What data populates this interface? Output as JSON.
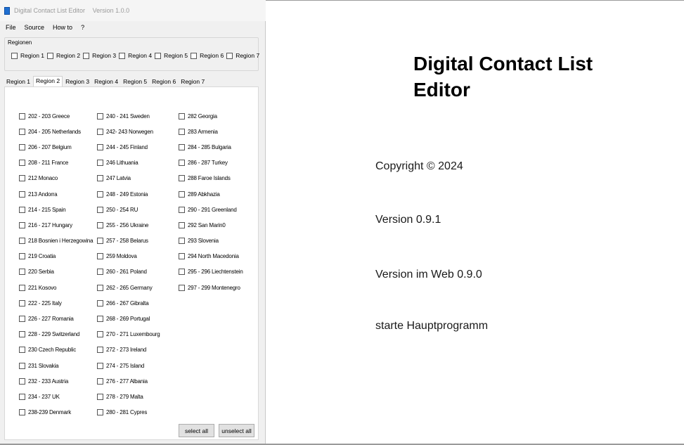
{
  "window": {
    "title": "Digital Contact List Editor",
    "version": "Version 1.0.0"
  },
  "menu": [
    "File",
    "Source",
    "How to",
    "?"
  ],
  "regionen": {
    "label": "Regionen",
    "checks": [
      "Region 1",
      "Region 2",
      "Region 3",
      "Region 4",
      "Region 5",
      "Region 6",
      "Region 7"
    ]
  },
  "tabs": [
    "Region 1",
    "Region 2",
    "Region 3",
    "Region 4",
    "Region 5",
    "Region 6",
    "Region 7"
  ],
  "active_tab": "Region 2",
  "countries": {
    "col1": [
      "202 - 203 Greece",
      "204 - 205 Netherlands",
      "206 - 207 Belgium",
      "208 - 211 France",
      "212 Monaco",
      "213 Andorra",
      "214 - 215 Spain",
      "216 - 217 Hungary",
      "218 Bosnien i Herzegowina",
      "219 Croatia",
      "220 Serbia",
      "221 Kosovo",
      "222 - 225 Italy",
      "226 - 227 Romania",
      "228 - 229 Switzerland",
      "230 Czech Republic",
      "231 Slovakia",
      "232 - 233 Austria",
      "234 - 237 UK",
      "238-239 Denmark"
    ],
    "col2": [
      "240 - 241 Sweden",
      "242- 243 Norwegen",
      "244 - 245 Finland",
      "246 Lithuania",
      "247 Latvia",
      "248 - 249 Estonia",
      "250 - 254 RU",
      "255 - 256 Ukraine",
      "257 - 258 Belarus",
      "259 Moldova",
      "260 - 261 Poland",
      "262 - 265 Germany",
      "266 - 267 Gibralta",
      "268 - 269 Portugal",
      "270 - 271 Luxembourg",
      "272 - 273 Ireland",
      "274 - 275 Island",
      "276 - 277 Albania",
      "278 - 279 Malta",
      "280 - 281 Cypres"
    ],
    "col3": [
      "282 Georgia",
      "283 Armenia",
      "284 - 285 Bulgaria",
      "286 - 287 Turkey",
      "288 Faroe Islands",
      "289 Abkhazia",
      "290 - 291 Greenland",
      "292 San Marin0",
      "293 Slovenia",
      "294 North Macedonia",
      "295 - 296 Liechtenstein",
      "297 - 299 Montenegro"
    ]
  },
  "buttons": {
    "select_all": "select all",
    "unselect_all": "unselect all"
  },
  "right": {
    "title_line1": "Digital Contact List",
    "title_line2": "Editor",
    "copyright": "Copyright © 2024",
    "version": "Version 0.9.1",
    "web_version": "Version im Web 0.9.0",
    "start": "starte Hauptprogramm"
  },
  "colors": {
    "window_bg": "#f0f0f0",
    "panel_bg": "#ffffff",
    "button_bg": "#e1e1e1",
    "app_icon": "#1f6fd1"
  }
}
